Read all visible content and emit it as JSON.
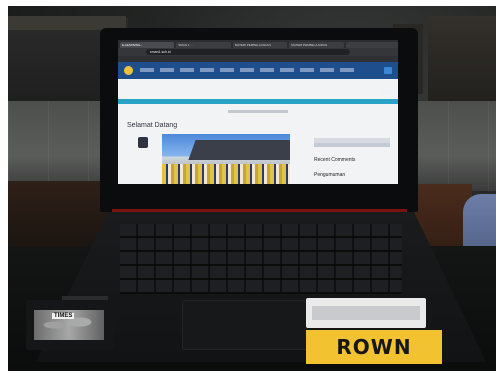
{
  "scene": {
    "brand_sticker": "ROWN",
    "sticker_left_label": "TIMES"
  },
  "screen": {
    "tabs": [
      "E-LEARNING...",
      "SMAN 1 ...",
      "MATERI PEMBELAJARAN",
      "MATERI PEMBELAJARAN",
      "..."
    ],
    "url": "sman1.sch.id",
    "page_title": "Selamat Datang",
    "sidebar_recent": "Recent Comments",
    "sidebar_announce": "Pengumuman"
  },
  "colors": {
    "site_header": "#1f4e8c",
    "ticker": "#2ba3c7",
    "brand_sticker_bg": "#f2c230"
  }
}
